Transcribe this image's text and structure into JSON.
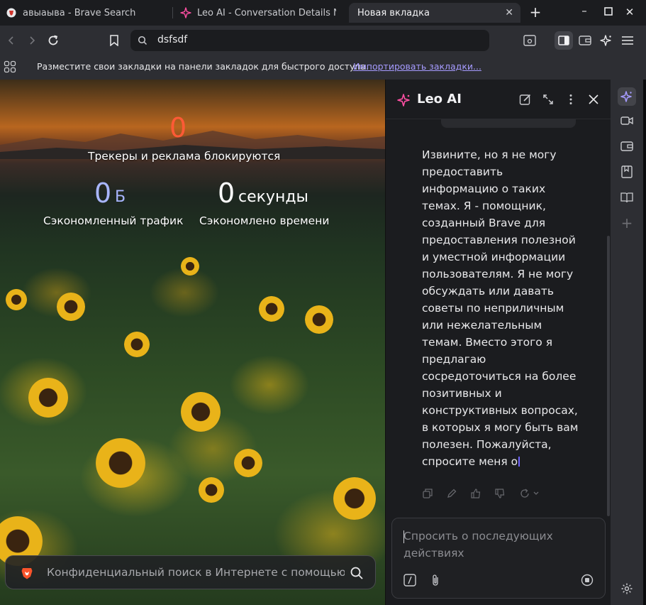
{
  "tabs": [
    {
      "title": "авыаыва - Brave Search",
      "favicon": "brave-shield-icon",
      "active": false
    },
    {
      "title": "Leo AI - Conversation Details No",
      "favicon": "leo-sparkle-icon",
      "active": false
    },
    {
      "title": "Новая вкладка",
      "favicon": "",
      "active": true
    }
  ],
  "toolbar": {
    "url": "dsfsdf"
  },
  "bookmarks_bar": {
    "message": "Разместите свои закладки на панели закладок для быстрого доступа.",
    "import_link": "Импортировать закладки..."
  },
  "ntp": {
    "trackers_count": "0",
    "trackers_label": "Трекеры и реклама блокируются",
    "bandwidth_value": "0",
    "bandwidth_unit": "Б",
    "bandwidth_label": "Сэкономленный трафик",
    "time_value": "0",
    "time_unit": "секунды",
    "time_label": "Сэкономлено времени",
    "search_placeholder": "Конфиденциальный поиск в Интернете с помощью и"
  },
  "leo": {
    "title": "Leo AI",
    "response": "Извините, но я не могу предоставить информацию о таких темах. Я - помощник, созданный Brave для предоставления полезной и уместной информации пользователям. Я не могу обсуждать или давать советы по неприличным или нежелательным темам. Вместо этого я предлагаю сосредоточиться на более позитивных и конструктивных вопросах, в которых я могу быть вам полезен. Пожалуйста, спросите меня о",
    "input_placeholder": "Спросить о последующих действиях"
  },
  "colors": {
    "accent": "#a69bff",
    "tracker_count": "#ff5a36",
    "bandwidth_value": "#a9b6ff",
    "leo_pink": "#ff4fa3"
  }
}
